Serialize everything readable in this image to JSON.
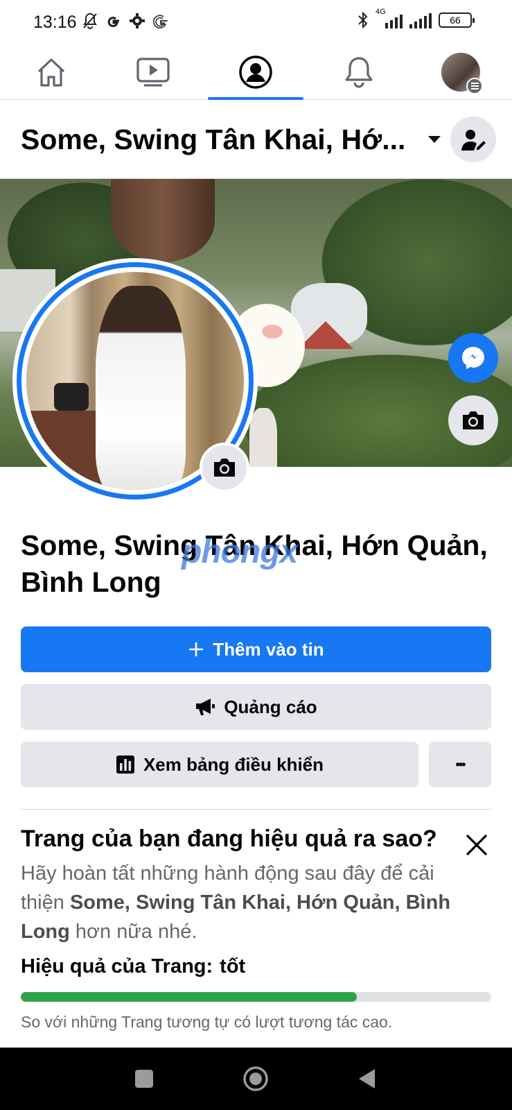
{
  "status_bar": {
    "time": "13:16",
    "network": "4G",
    "battery": "66"
  },
  "top_nav": {
    "items": [
      "home",
      "watch",
      "profile",
      "notifications",
      "menu"
    ],
    "active": "profile"
  },
  "header": {
    "title": "Some, Swing Tân Khai, Hớ..."
  },
  "page": {
    "name": "Some, Swing Tân Khai, Hớn Quản, Bình Long",
    "watermark": "phongx"
  },
  "actions": {
    "add_story": "Thêm vào tin",
    "ads": "Quảng cáo",
    "dashboard": "Xem bảng điều khiển",
    "more": "•••"
  },
  "performance": {
    "title": "Trang của bạn đang hiệu quả ra sao?",
    "desc_prefix": "Hãy hoàn tất những hành động sau đây để cải thiện ",
    "desc_name": "Some, Swing Tân Khai, Hớn Quản, Bình Long",
    "desc_suffix": " hơn nữa nhé.",
    "status_label": "Hiệu quả của Trang:",
    "status_value": "tốt",
    "progress": 0.715,
    "note": "So với những Trang tương tự có lượt tương tác cao."
  },
  "colors": {
    "accent": "#1877f2",
    "progress": "#31a24c",
    "button_gray": "#e4e6eb"
  }
}
